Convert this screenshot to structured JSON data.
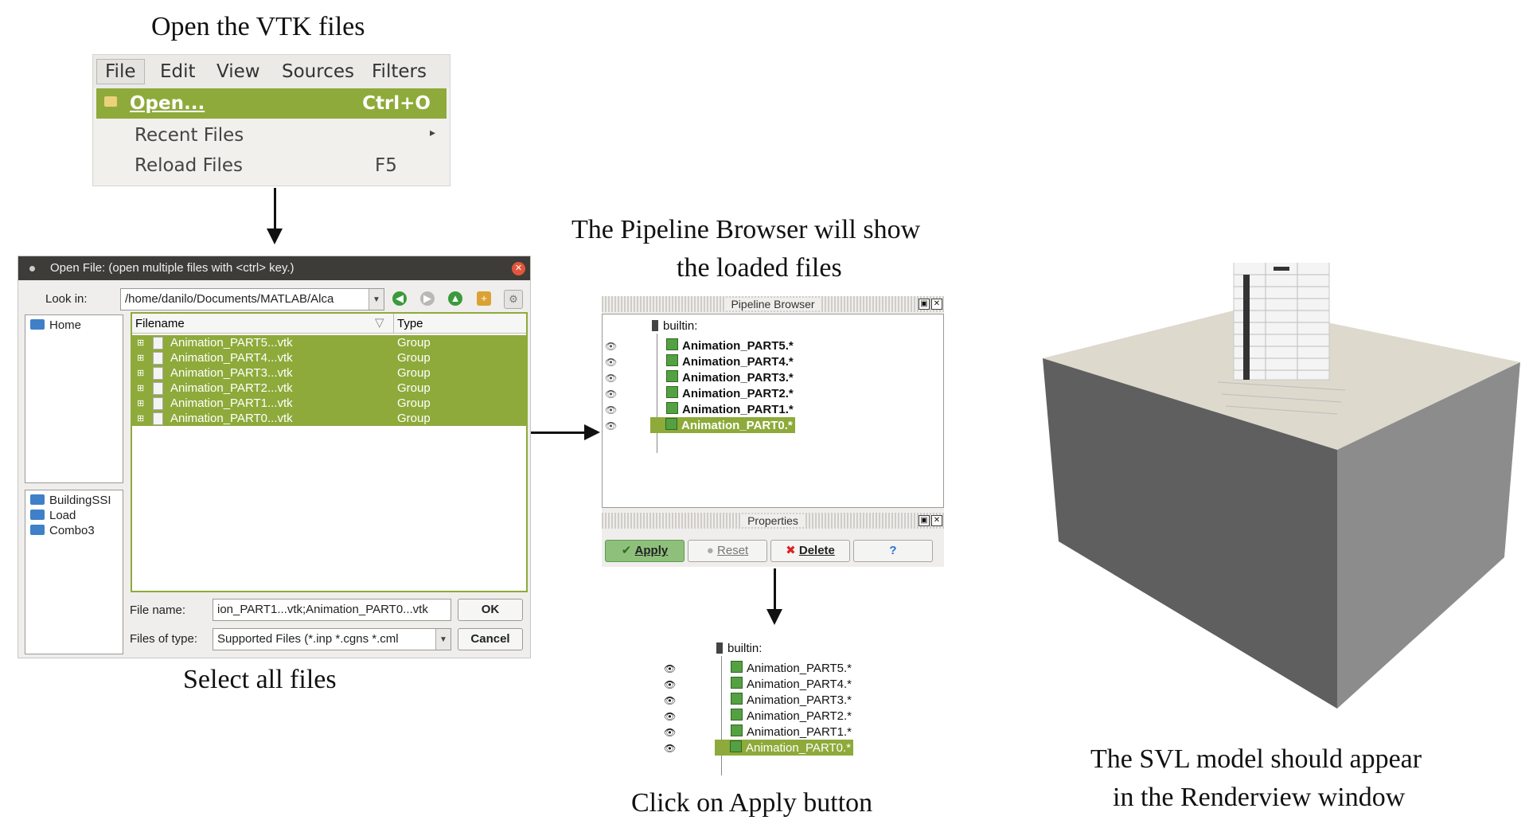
{
  "captions": {
    "open_vtk": "Open the VTK files",
    "select_all": "Select all files",
    "pipeline_line1": "The Pipeline Browser will show",
    "pipeline_line2": "the loaded files",
    "apply": "Click on Apply button",
    "svl_line1": "The SVL model should appear",
    "svl_line2": "in the Renderview window"
  },
  "menu": {
    "bar": [
      "File",
      "Edit",
      "View",
      "Sources",
      "Filters"
    ],
    "items": [
      {
        "label": "Open...",
        "shortcut": "Ctrl+O",
        "selected": true,
        "icon": "folder-open-icon"
      },
      {
        "label": "Recent Files",
        "shortcut": "▸",
        "selected": false
      },
      {
        "label": "Reload Files",
        "shortcut": "F5",
        "selected": false
      }
    ]
  },
  "dialog": {
    "title": "Open File:  (open multiple files with <ctrl> key.)",
    "look_in_label": "Look in:",
    "look_in_value": "/home/danilo/Documents/MATLAB/Alca",
    "places_top": [
      "Home"
    ],
    "places_bottom": [
      "BuildingSSI",
      "Load",
      "Combo3"
    ],
    "columns": [
      "Filename",
      "Type"
    ],
    "files": [
      {
        "name": "Animation_PART5...vtk",
        "type": "Group"
      },
      {
        "name": "Animation_PART4...vtk",
        "type": "Group"
      },
      {
        "name": "Animation_PART3...vtk",
        "type": "Group"
      },
      {
        "name": "Animation_PART2...vtk",
        "type": "Group"
      },
      {
        "name": "Animation_PART1...vtk",
        "type": "Group"
      },
      {
        "name": "Animation_PART0...vtk",
        "type": "Group"
      }
    ],
    "filename_label": "File name:",
    "filename_value": "ion_PART1...vtk;Animation_PART0...vtk",
    "filetype_label": "Files of type:",
    "filetype_value": "Supported Files (*.inp  *.cgns  *.cml",
    "ok": "OK",
    "cancel": "Cancel"
  },
  "pipeline": {
    "title": "Pipeline Browser",
    "root": "builtin:",
    "items": [
      "Animation_PART5.*",
      "Animation_PART4.*",
      "Animation_PART3.*",
      "Animation_PART2.*",
      "Animation_PART1.*",
      "Animation_PART0.*"
    ],
    "properties_title": "Properties",
    "buttons": {
      "apply": "Apply",
      "reset": "Reset",
      "delete": "Delete",
      "help": "?"
    }
  },
  "pipeline_small": {
    "root": "builtin:",
    "items": [
      "Animation_PART5.*",
      "Animation_PART4.*",
      "Animation_PART3.*",
      "Animation_PART2.*",
      "Animation_PART1.*",
      "Animation_PART0.*"
    ]
  },
  "colors": {
    "selection": "#8eaa3a",
    "cube_green": "#55a042",
    "close_red": "#e2553a",
    "soil_top": "#ddd9cc",
    "soil_side_dark": "#5f5f5f",
    "soil_side_light": "#8c8c8c"
  }
}
